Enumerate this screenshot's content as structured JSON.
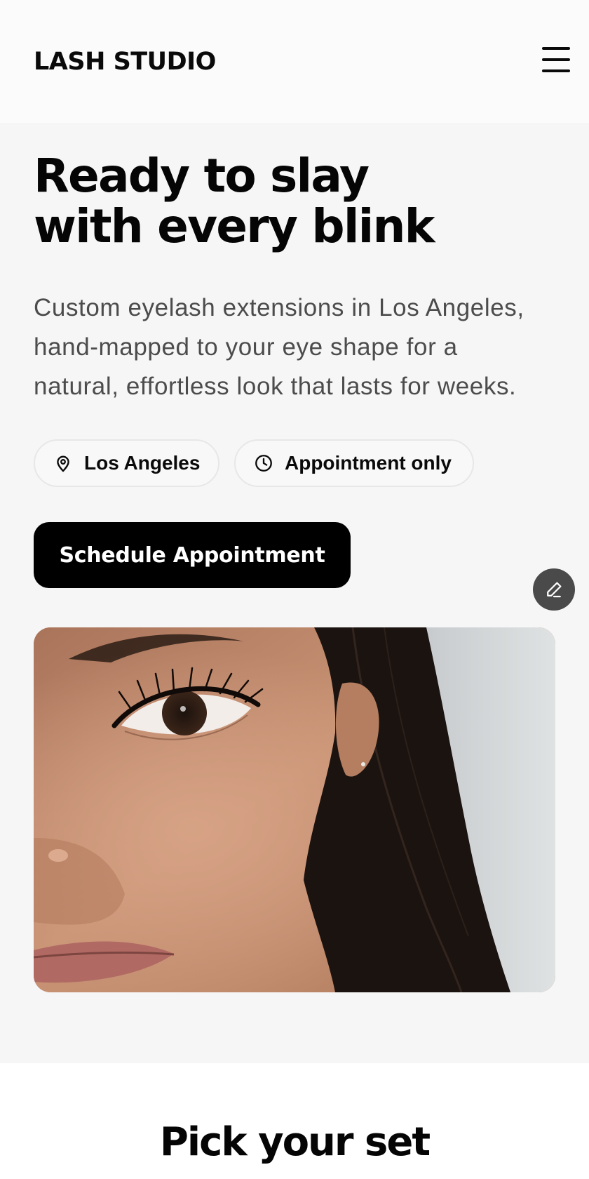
{
  "header": {
    "logo": "LASH STUDIO",
    "menu_icon": "hamburger-menu-icon"
  },
  "hero": {
    "headline_lines": [
      "Ready to slay",
      "with every blink"
    ],
    "subtext_lines": [
      "Custom eyelash extensions in Los Angeles,",
      "hand-mapped to your eye shape for a",
      "natural, effortless look that lasts for weeks."
    ],
    "chips": [
      {
        "icon": "location-pin-icon",
        "label": "Los Angeles"
      },
      {
        "icon": "clock-icon",
        "label": "Appointment only"
      }
    ],
    "cta_label": "Schedule Appointment",
    "edit_icon": "pencil-icon",
    "photo_alt": "Close-up of a woman's eye with eyelash extensions"
  },
  "sets": {
    "title": "Pick your set"
  },
  "colors": {
    "header_bg": "#fbfbfb",
    "hero_bg": "#f6f6f6",
    "text": "#0a0a0a",
    "muted_text": "#4c4c4c",
    "cta_bg": "#000000",
    "cta_text": "#ffffff",
    "fab_bg": "#4a4a4a"
  }
}
